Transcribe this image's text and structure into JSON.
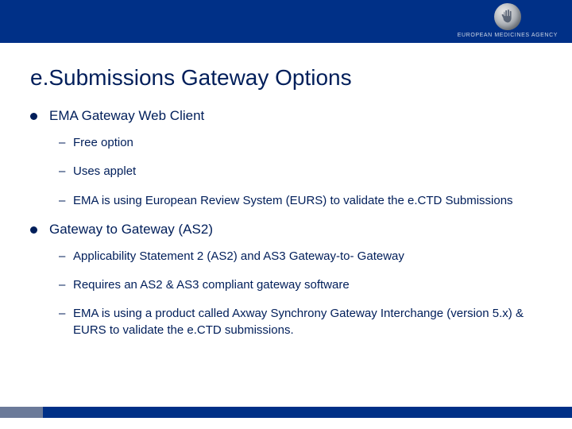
{
  "header": {
    "agency_name": "EUROPEAN MEDICINES AGENCY"
  },
  "title": "e.Submissions Gateway Options",
  "bullets": [
    {
      "label": "EMA Gateway Web Client",
      "sub": [
        "Free option",
        "Uses applet",
        "EMA is using European Review System (EURS) to validate the e.CTD Submissions"
      ]
    },
    {
      "label": "Gateway to Gateway (AS2)",
      "sub": [
        "Applicability Statement 2 (AS2) and AS3 Gateway-to- Gateway",
        "Requires an AS2 & AS3 compliant gateway software",
        "EMA is using a product called Axway Synchrony Gateway Interchange (version 5.x) & EURS to validate the e.CTD submissions."
      ]
    }
  ]
}
